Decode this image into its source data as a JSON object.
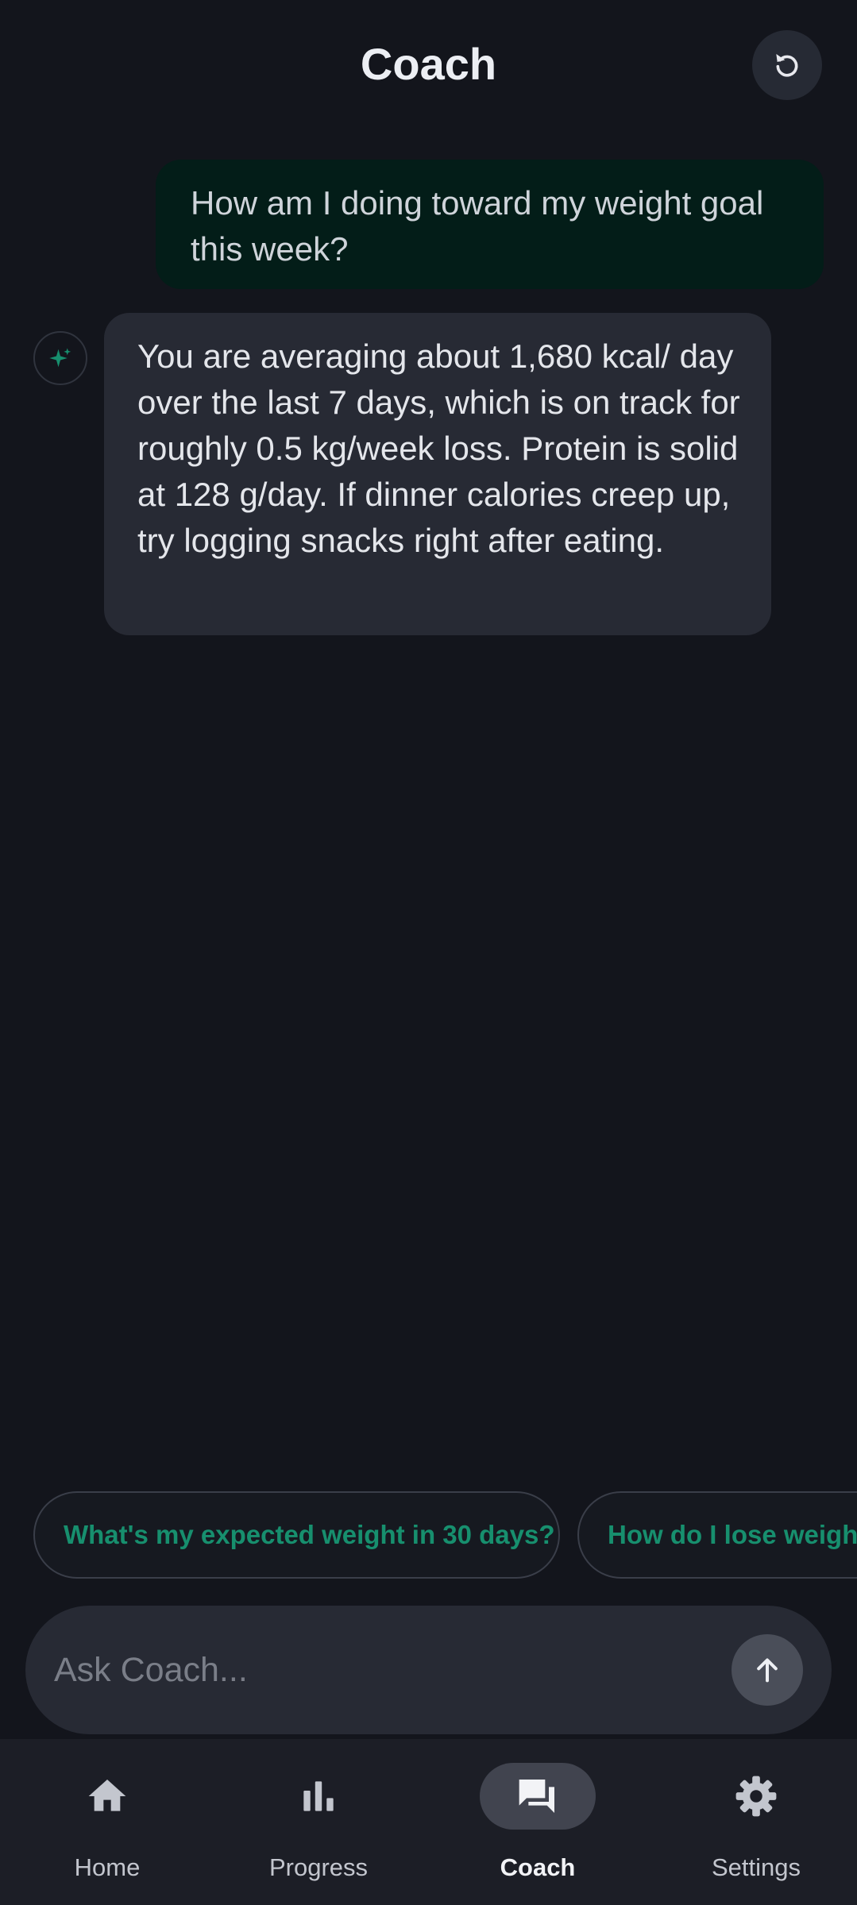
{
  "header": {
    "title": "Coach"
  },
  "messages": {
    "user": "How am I doing toward my weight goal this week?",
    "coach": "You are averaging about 1,680 kcal/ day over the last 7 days, which is on track for roughly 0.5 kg/week loss. Protein is solid at 128 g/day. If dinner calories creep up, try logging snacks right after eating."
  },
  "suggestions": [
    "What's my expected weight in 30 days?",
    "How do I lose weight"
  ],
  "input": {
    "placeholder": "Ask Coach...",
    "value": ""
  },
  "nav": {
    "items": [
      {
        "label": "Home",
        "icon": "home-icon"
      },
      {
        "label": "Progress",
        "icon": "bar-chart-icon"
      },
      {
        "label": "Coach",
        "icon": "chat-icon",
        "active": true
      },
      {
        "label": "Settings",
        "icon": "gear-icon"
      }
    ]
  },
  "colors": {
    "background": "#13151c",
    "accent": "#178f6e",
    "user_bubble": "#031d18",
    "coach_bubble": "#272a34"
  }
}
